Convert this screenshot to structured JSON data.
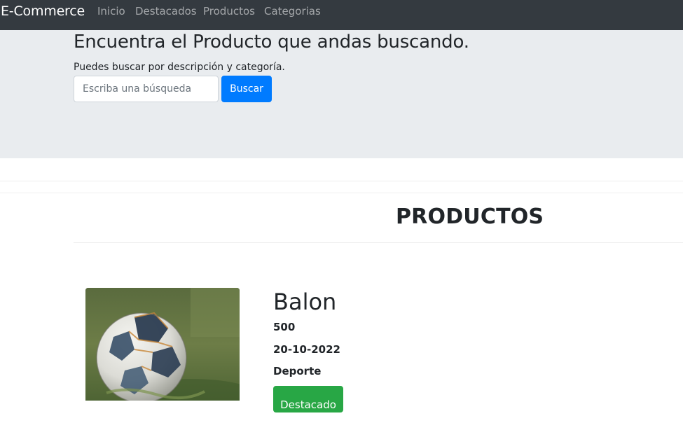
{
  "navbar": {
    "brand": "E-Commerce",
    "links": [
      "Inicio",
      "Destacados",
      "Productos",
      "Categorias"
    ]
  },
  "hero": {
    "title": "Encuentra el Producto que andas buscando.",
    "subtitle": "Puedes buscar por descripción y categoría.",
    "search_placeholder": "Escriba una búsqueda",
    "search_button": "Buscar"
  },
  "products_section": {
    "title": "PRODUCTOS"
  },
  "products": [
    {
      "name": "Balon",
      "price": "500",
      "date": "20-10-2022",
      "category": "Deporte",
      "badge": "Destacado",
      "image_icon": "soccer-ball-photo"
    }
  ],
  "colors": {
    "navbar": "#343a40",
    "jumbotron": "#e9ecef",
    "primary": "#007bff",
    "success": "#28a745"
  }
}
